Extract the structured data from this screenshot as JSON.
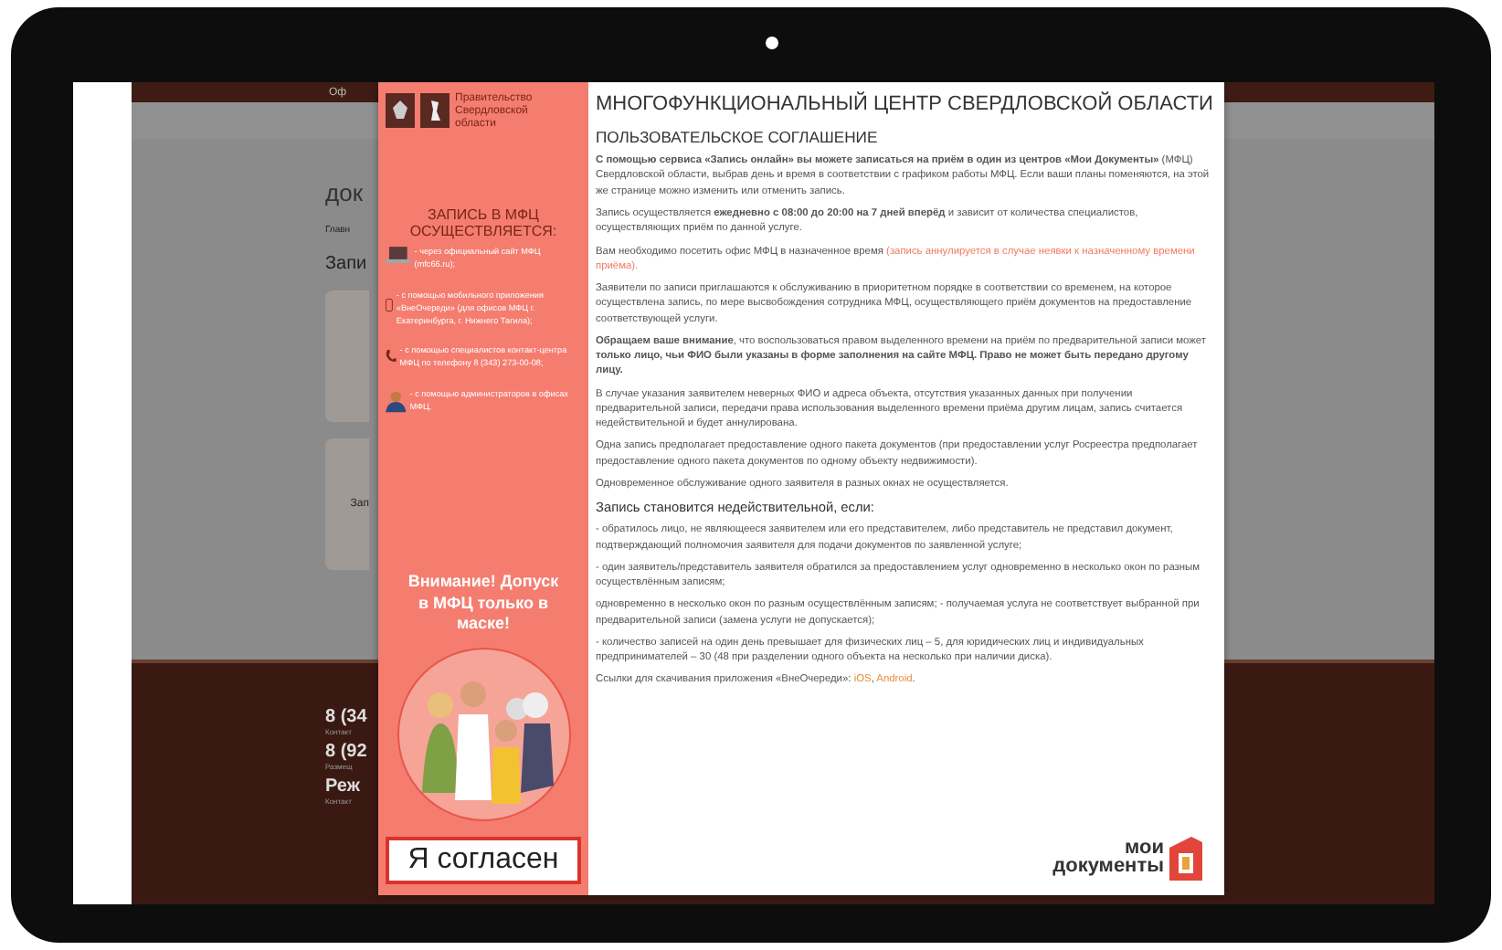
{
  "backdrop": {
    "top_bar_text": "Оф",
    "heading": "док",
    "breadcrumb": "Главн",
    "section_title": "Запи",
    "card_text": "Зап",
    "footer": [
      {
        "phone": "8 (34",
        "caption": "Контакт"
      },
      {
        "phone": "8 (92",
        "caption": "Размещ"
      },
      {
        "phone": "Реж",
        "caption": "Контакт"
      }
    ]
  },
  "modal": {
    "sidebar": {
      "government": "Правительство Свердловской области",
      "title": "ЗАПИСЬ В МФЦ ОСУЩЕСТВЛЯЕТСЯ:",
      "methods": [
        {
          "kind": "laptop",
          "text": "- через официальный сайт МФЦ (mfc66.ru);"
        },
        {
          "kind": "phone",
          "text": "- с помощью мобильного приложения «ВнеОчереди» (для офисов МФЦ г. Екатеринбурга, г. Нижнего Тагила);"
        },
        {
          "kind": "handset",
          "text": "- с помощью специалистов контакт-центра МФЦ по телефону 8 (343) 273-00-08;"
        },
        {
          "kind": "person",
          "text": "- с помощью администраторов в офисах МФЦ."
        }
      ],
      "warning": "Внимание! Допуск в МФЦ только в маске!",
      "accept_button": "Я согласен"
    },
    "title": "МНОГОФУНКЦИОНАЛЬНЫЙ ЦЕНТР СВЕРДЛОВСКОЙ ОБЛАСТИ",
    "subtitle": "ПОЛЬЗОВАТЕЛЬСКОЕ СОГЛАШЕНИЕ",
    "paragraphs": [
      {
        "kind": "text",
        "text": "**С помощью сервиса «Запись онлайн» вы можете записаться на приём в один из центров «Мои Документы»** (МФЦ) Свердловской области, выбрав день и время в соответствии с графиком работы МФЦ. Если ваши планы поменяются, на этой же странице можно изменить или отменить запись."
      },
      {
        "kind": "text",
        "text": "Запись осуществляется **ежедневно с 08:00 до 20:00 на 7 дней вперёд** и зависит от количества специалистов, осуществляющих приём по данной услуге."
      },
      {
        "kind": "text",
        "text": "Вам необходимо посетить офис МФЦ в назначенное время",
        "note": "(запись аннулируется в случае неявки к назначенному времени приёма)."
      },
      {
        "kind": "text",
        "text": "Заявители по записи приглашаются к обслуживанию в приоритетном порядке в соответствии со временем, на которое осуществлена запись, по мере высвобождения сотрудника МФЦ, осуществляющего приём документов на предоставление соответствующей услуги."
      },
      {
        "kind": "text",
        "text": "**Обращаем ваше внимание**, что воспользоваться правом выделенного времени на приём по предварительной записи может **только лицо, чьи ФИО были указаны в форме заполнения на сайте МФЦ. Право не может быть передано другому лицу.**"
      },
      {
        "kind": "text",
        "text": "В случае указания заявителем неверных ФИО и адреса объекта, отсутствия указанных данных при получении предварительной записи, передачи права использования выделенного времени приёма другим лицам, запись считается недействительной и будет аннулирована."
      },
      {
        "kind": "text",
        "text": "Одна запись предполагает предоставление одного пакета документов (при предоставлении услуг Росреестра предполагает предоставление одного пакета документов по одному объекту недвижимости)."
      },
      {
        "kind": "text",
        "text": "Одновременное обслуживание одного заявителя в разных окнах не осуществляется."
      },
      {
        "kind": "heading",
        "text": "Запись становится недействительной, если:"
      },
      {
        "kind": "text",
        "text": "- обратилось лицо, не являющееся заявителем или его представителем, либо представитель не представил документ, подтверждающий полномочия заявителя для подачи документов по заявленной услуге;"
      },
      {
        "kind": "text",
        "text": "- один заявитель/представитель заявителя обратился за предоставлением услуг одновременно в несколько окон по разным осуществлённым записям;"
      },
      {
        "kind": "text",
        "text": "одновременно в несколько окон по разным осуществлённым записям; - получаемая услуга не соответствует выбранной при предварительной записи (замена услуги не допускается);"
      },
      {
        "kind": "text",
        "text": "- количество записей на один день превышает для физических лиц – 5, для юридических лиц и индивидуальных предпринимателей – 30 (48 при разделении одного объекта на несколько при наличии диска)."
      },
      {
        "kind": "links",
        "text": "Ссылки для скачивания приложения «ВнеОчереди»:",
        "links": [
          "iOS",
          "Android"
        ],
        "separator": ",",
        "end": "."
      }
    ],
    "brand": {
      "top": "мои",
      "bottom": "документы"
    }
  }
}
